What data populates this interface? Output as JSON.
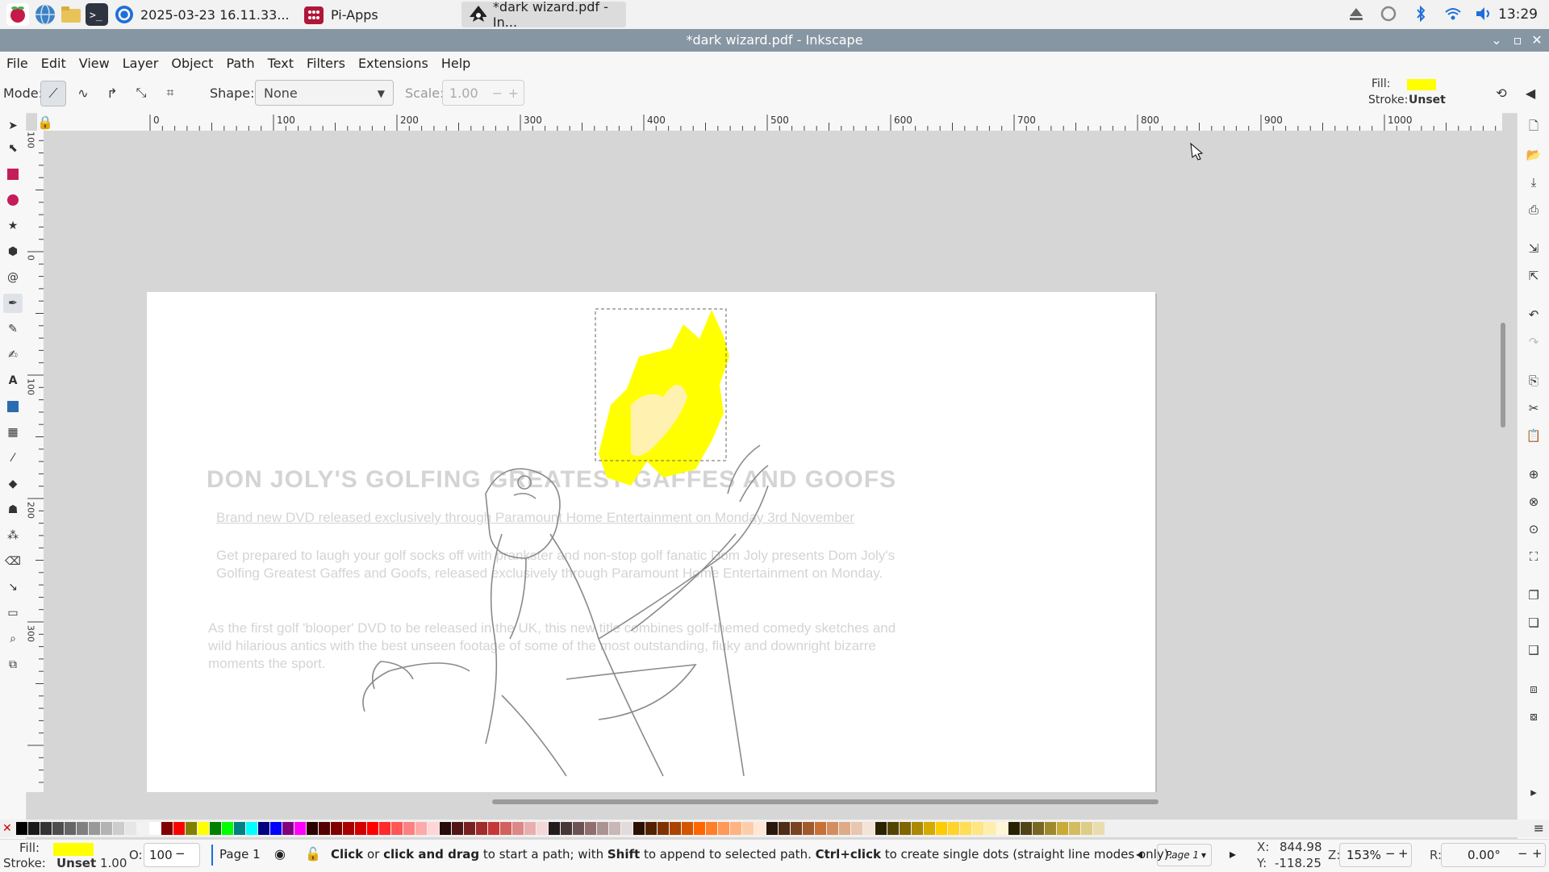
{
  "taskbar": {
    "tasks": [
      {
        "label": "2025-03-23 16.11.33..."
      },
      {
        "label": "Pi-Apps"
      },
      {
        "label": "*dark wizard.pdf - In..."
      }
    ],
    "clock": "13:29"
  },
  "window": {
    "title": "*dark wizard.pdf - Inkscape"
  },
  "menu": [
    "File",
    "Edit",
    "View",
    "Layer",
    "Object",
    "Path",
    "Text",
    "Filters",
    "Extensions",
    "Help"
  ],
  "toolctl": {
    "mode_label": "Mode:",
    "shape_label": "Shape:",
    "shape_value": "None",
    "scale_label": "Scale:",
    "scale_value": "1.00",
    "fill_label": "Fill:",
    "stroke_label": "Stroke:",
    "stroke_value": "Unset",
    "fill_color": "#ffff00"
  },
  "ruler": {
    "h_labels": [
      "0",
      "100",
      "200",
      "300",
      "400",
      "500",
      "600",
      "700",
      "800",
      "900",
      "1000"
    ],
    "v_labels": [
      "100",
      "0",
      "100",
      "200",
      "300"
    ]
  },
  "document": {
    "heading": "DON JOLY'S GOLFING GREATEST GAFFES AND GOOFS",
    "subheading": "Brand new DVD released exclusively through Paramount Home Entertainment on Monday 3rd November",
    "para1": "Get prepared to laugh your golf socks off with prankster and non-stop golf fanatic Dom Joly presents Dom Joly's Golfing Greatest Gaffes and Goofs, released exclusively through Paramount Home Entertainment on Monday.",
    "para2": "As the first golf 'blooper' DVD to be released in the UK, this new title combines golf-themed comedy sketches and wild hilarious antics with the best unseen footage of some of the most outstanding, fluky and downright bizarre moments the sport."
  },
  "status": {
    "fill_label": "Fill:",
    "stroke_label": "Stroke:",
    "stroke_value": "Unset",
    "stroke_width": "1.00",
    "opacity_label": "O:",
    "opacity_value": "100",
    "layer": "Page 1",
    "message_parts": [
      "Click",
      " or ",
      "click and drag",
      " to start a path; with ",
      "Shift",
      " to append to selected path. ",
      "Ctrl+click",
      " to create single dots (straight line modes only)."
    ],
    "page_select": "Page 1",
    "x_label": "X:",
    "x_value": "844.98",
    "y_label": "Y:",
    "y_value": "-118.25",
    "zoom_label": "Z:",
    "zoom_value": "153%",
    "rot_label": "R:",
    "rot_value": "0.00°",
    "fill_color": "#ffff00"
  },
  "palette": [
    "#000000",
    "#1a1a1a",
    "#333333",
    "#4d4d4d",
    "#666666",
    "#808080",
    "#999999",
    "#b3b3b3",
    "#cccccc",
    "#e6e6e6",
    "#f2f2f2",
    "#ffffff",
    "#800000",
    "#ff0000",
    "#808000",
    "#ffff00",
    "#008000",
    "#00ff00",
    "#008080",
    "#00ffff",
    "#000080",
    "#0000ff",
    "#800080",
    "#ff00ff",
    "#2b0000",
    "#550000",
    "#800000",
    "#aa0000",
    "#d40000",
    "#ff0000",
    "#ff2a2a",
    "#ff5555",
    "#ff8080",
    "#ffaaaa",
    "#ffd5d5",
    "#280b0b",
    "#501616",
    "#782121",
    "#a02c2c",
    "#c83737",
    "#d35f5f",
    "#de8787",
    "#e9afaf",
    "#f4d7d7",
    "#241c1c",
    "#483737",
    "#6c5353",
    "#916f6f",
    "#ac9393",
    "#c8b7b7",
    "#e3dbdb",
    "#2b1100",
    "#552200",
    "#803300",
    "#aa4400",
    "#d45500",
    "#ff6600",
    "#ff7f2a",
    "#ff9955",
    "#ffb380",
    "#ffccaa",
    "#ffe6d5",
    "#28170b",
    "#502d16",
    "#784421",
    "#a05a2c",
    "#c87137",
    "#d38d5f",
    "#deaa87",
    "#e9c6af",
    "#f4e3d7",
    "#2b2200",
    "#554400",
    "#806600",
    "#aa8800",
    "#d4aa00",
    "#ffcc00",
    "#ffd42a",
    "#ffdd55",
    "#ffe680",
    "#ffeeaa",
    "#fff6d5",
    "#282200",
    "#504416",
    "#786721",
    "#a0892c",
    "#c8ab37",
    "#d3bc5f",
    "#decd87",
    "#e9ddaf"
  ]
}
